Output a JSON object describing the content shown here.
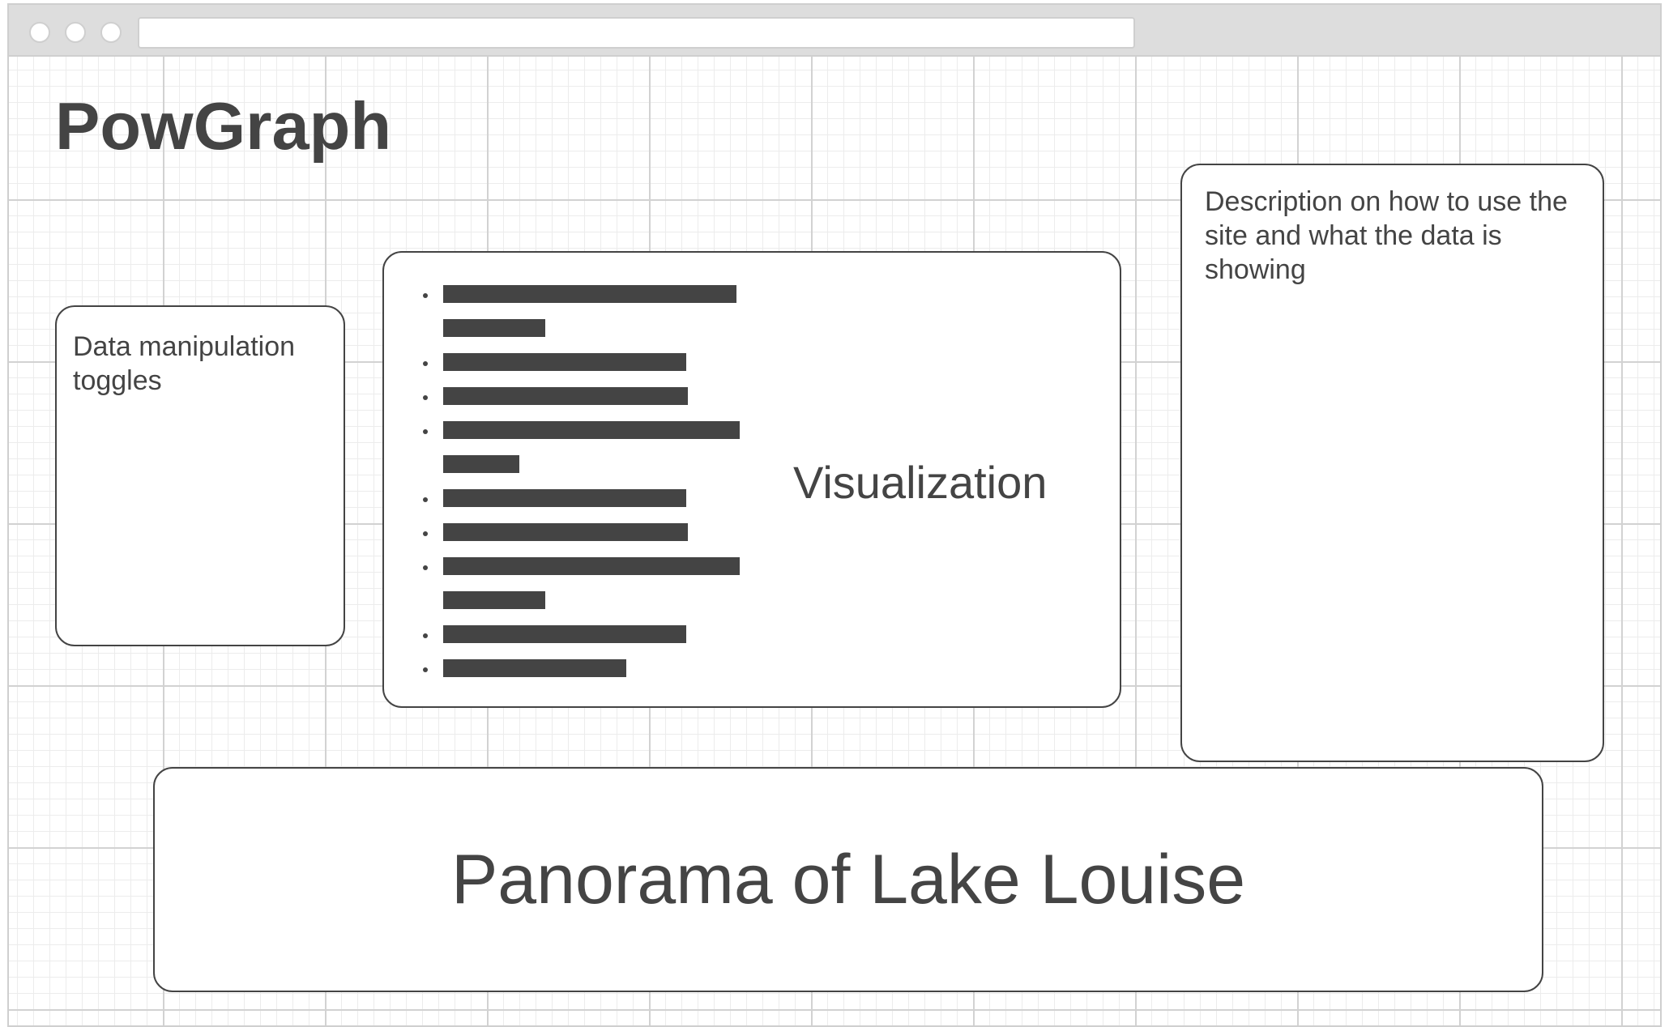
{
  "app": {
    "title": "PowGraph"
  },
  "toggles_panel": {
    "text": "Data manipulation toggles"
  },
  "visualization_panel": {
    "label": "Visualization",
    "placeholder_bullets": 10
  },
  "description_panel": {
    "text": "Description on how to use the site and what the data is showing"
  },
  "panorama_panel": {
    "text": "Panorama of Lake Louise"
  },
  "colors": {
    "text": "#444444",
    "border": "#444444",
    "chrome": "#dddddd",
    "grid": "#d2d2d2"
  }
}
